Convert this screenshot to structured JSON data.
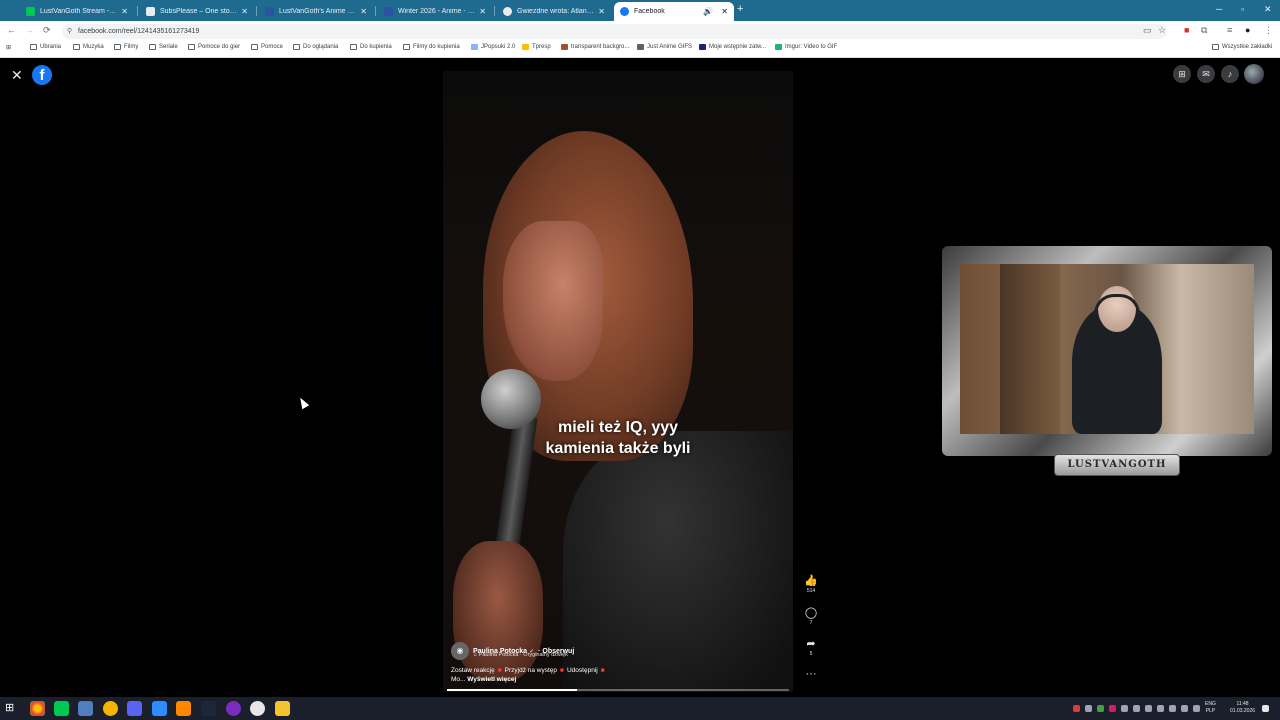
{
  "browser": {
    "tabs": [
      {
        "title": "LustVanGoth Stream - Watch L",
        "favicon_color": "#00c853"
      },
      {
        "title": "SubsPlease – One stop shop fo",
        "favicon_color": "#e8eaed"
      },
      {
        "title": "LustVanGoth's Anime List - My",
        "favicon_color": "#2e51a2"
      },
      {
        "title": "Winter 2026 - Anime - MyAnim",
        "favicon_color": "#2e51a2"
      },
      {
        "title": "Gwiezdne wrota: Atlantyda / St",
        "favicon_color": "#e8eaed"
      },
      {
        "title": "Facebook",
        "favicon_color": "#1877f2"
      }
    ],
    "new_tab_label": "+",
    "url": "facebook.com/reel/1241435161273419",
    "bookmarks": [
      {
        "label": "Ubrania",
        "icon": "folder-icon"
      },
      {
        "label": "Muzyka",
        "icon": "folder-icon"
      },
      {
        "label": "Filmy",
        "icon": "folder-icon"
      },
      {
        "label": "Seriale",
        "icon": "folder-icon"
      },
      {
        "label": "Pomoce do gier",
        "icon": "folder-icon"
      },
      {
        "label": "Pomoce",
        "icon": "folder-icon"
      },
      {
        "label": "Do oglądania",
        "icon": "folder-icon"
      },
      {
        "label": "Do kupienia",
        "icon": "folder-icon"
      },
      {
        "label": "Filmy do kupienia",
        "icon": "folder-icon"
      },
      {
        "label": "JPopsuki 2.0",
        "icon": "site-icon"
      },
      {
        "label": "Tpresp",
        "icon": "site-icon"
      },
      {
        "label": "transparent backgro...",
        "icon": "site-icon"
      },
      {
        "label": "Just Anime GIFS",
        "icon": "site-icon"
      },
      {
        "label": "Moje wstępnie zatw...",
        "icon": "site-icon"
      },
      {
        "label": "Imgur: Video to GIF",
        "icon": "site-icon"
      }
    ],
    "all_bookmarks_label": "Wszystkie zakładki"
  },
  "facebook": {
    "logo": "f",
    "subtitle_line1": "mieli też IQ, yyy",
    "subtitle_line2": "kamienia także byli",
    "author": {
      "name": "Paulina Potocka",
      "verified": "✓",
      "follow": "· Obserwuj",
      "audio": "♫ Paulina Potocka · Oryginalny dźwięk"
    },
    "caption": {
      "part1": "Zostaw reakcję",
      "part2": "Przyjdź na występ",
      "part3": "Udostępnij",
      "part4": "Mo...",
      "more": "Wyświetl więcej",
      "separator": "■"
    },
    "actions": {
      "likes": "514",
      "comments": "7",
      "shares": "5",
      "more": "···"
    },
    "progress": 0.38
  },
  "overlay": {
    "nameplate": "LUSTVANGOTH"
  },
  "taskbar": {
    "lang_line1": "ENG",
    "lang_line2": "PLP",
    "time": "11:48",
    "date": "01.03.2026"
  }
}
